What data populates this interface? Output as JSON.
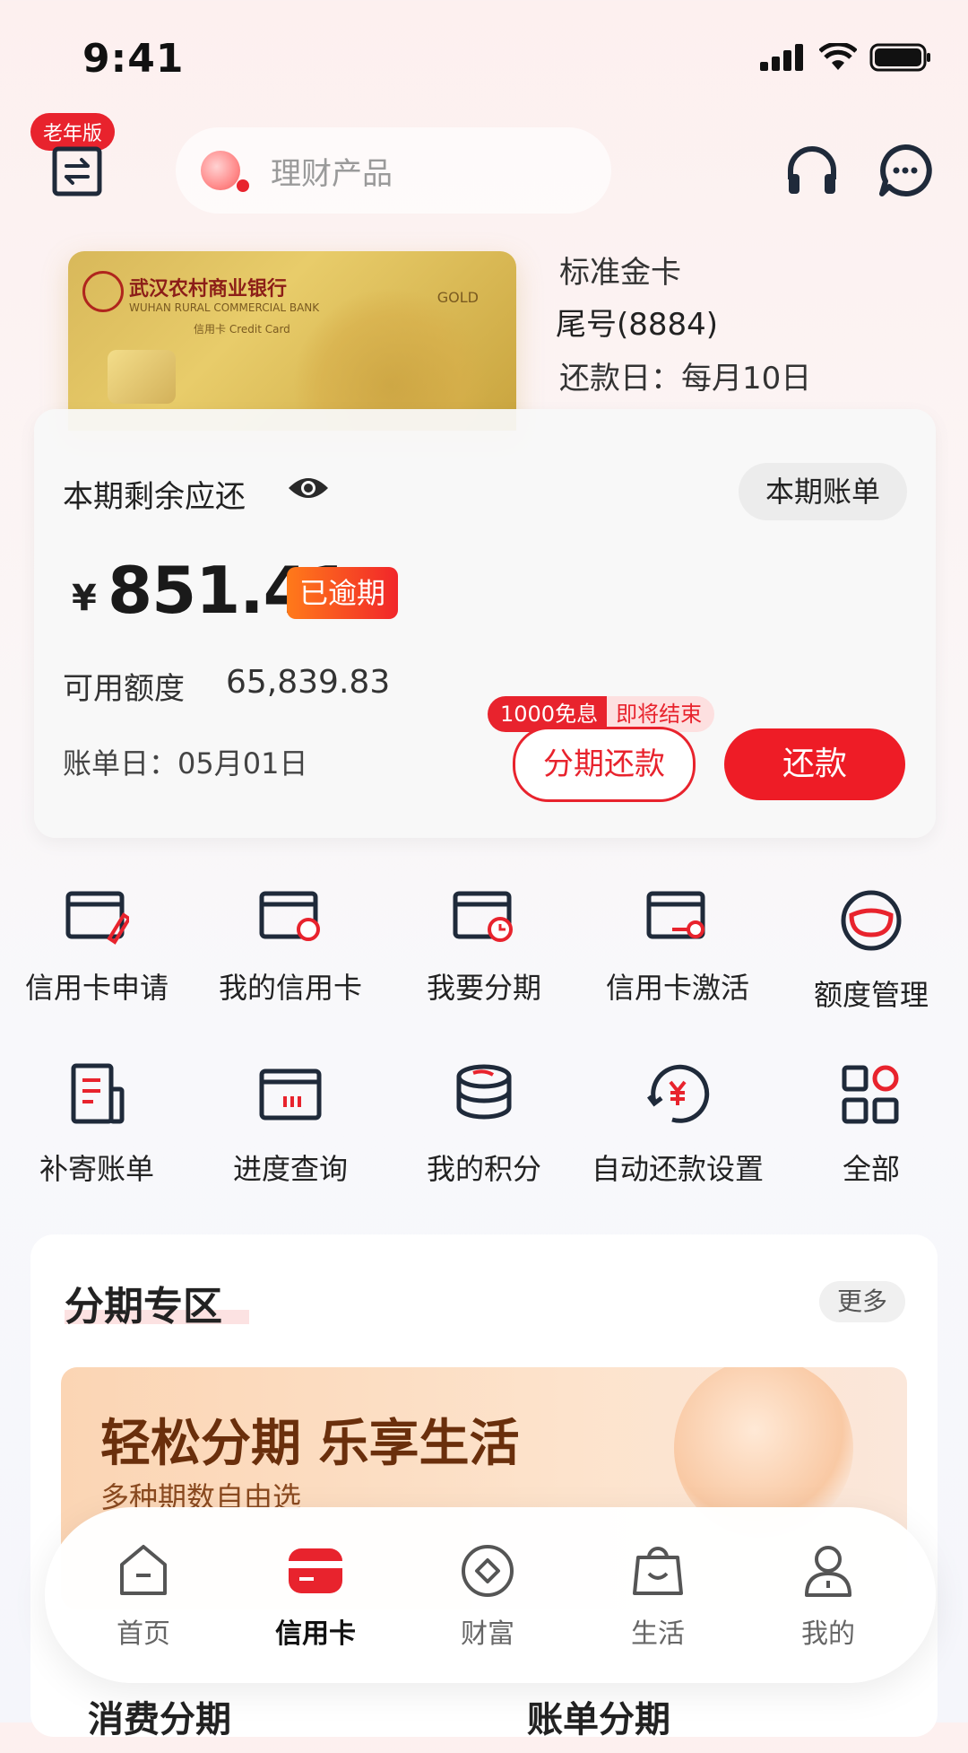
{
  "status_bar": {
    "time": "9:41"
  },
  "header": {
    "elder_badge": "老年版",
    "search_placeholder": "理财产品"
  },
  "card": {
    "bank_name": "武汉农村商业银行",
    "bank_name_en": "WUHAN RURAL COMMERCIAL BANK",
    "card_label": "信用卡 Credit Card",
    "tier_mark": "GOLD",
    "name": "标准金卡",
    "tail": "尾号(8884)",
    "due_day": "还款日：每月10日"
  },
  "bill": {
    "label": "本期剩余应还",
    "statement_button": "本期账单",
    "currency": "¥",
    "amount": "851.41",
    "overdue_tag": "已逾期",
    "credit_label": "可用额度",
    "credit_value": "65,839.83",
    "bill_day": "账单日：05月01日",
    "promo_left": "1000免息",
    "promo_right": "即将结束",
    "installment_button": "分期还款",
    "repay_button": "还款"
  },
  "services": [
    {
      "label": "信用卡申请",
      "icon": "card-apply-icon"
    },
    {
      "label": "我的信用卡",
      "icon": "my-card-icon"
    },
    {
      "label": "我要分期",
      "icon": "installment-clock-icon"
    },
    {
      "label": "信用卡激活",
      "icon": "card-activate-icon"
    },
    {
      "label": "额度管理",
      "icon": "limit-gauge-icon"
    },
    {
      "label": "补寄账单",
      "icon": "bill-document-icon"
    },
    {
      "label": "进度查询",
      "icon": "progress-query-icon"
    },
    {
      "label": "我的积分",
      "icon": "points-coins-icon"
    },
    {
      "label": "自动还款设置",
      "icon": "auto-repay-icon"
    },
    {
      "label": "全部",
      "icon": "all-grid-icon"
    }
  ],
  "installment_section": {
    "title": "分期专区",
    "more": "更多",
    "banner_title": "轻松分期 乐享生活",
    "banner_sub": "多种期数自由选",
    "card_left": "消费分期",
    "card_right": "账单分期"
  },
  "tabbar": [
    {
      "label": "首页",
      "icon": "home-icon",
      "active": false
    },
    {
      "label": "信用卡",
      "icon": "credit-card-icon",
      "active": true
    },
    {
      "label": "财富",
      "icon": "wealth-icon",
      "active": false
    },
    {
      "label": "生活",
      "icon": "life-bag-icon",
      "active": false
    },
    {
      "label": "我的",
      "icon": "profile-icon",
      "active": false
    }
  ],
  "colors": {
    "accent": "#e8232d",
    "text": "#1f1f1f"
  }
}
